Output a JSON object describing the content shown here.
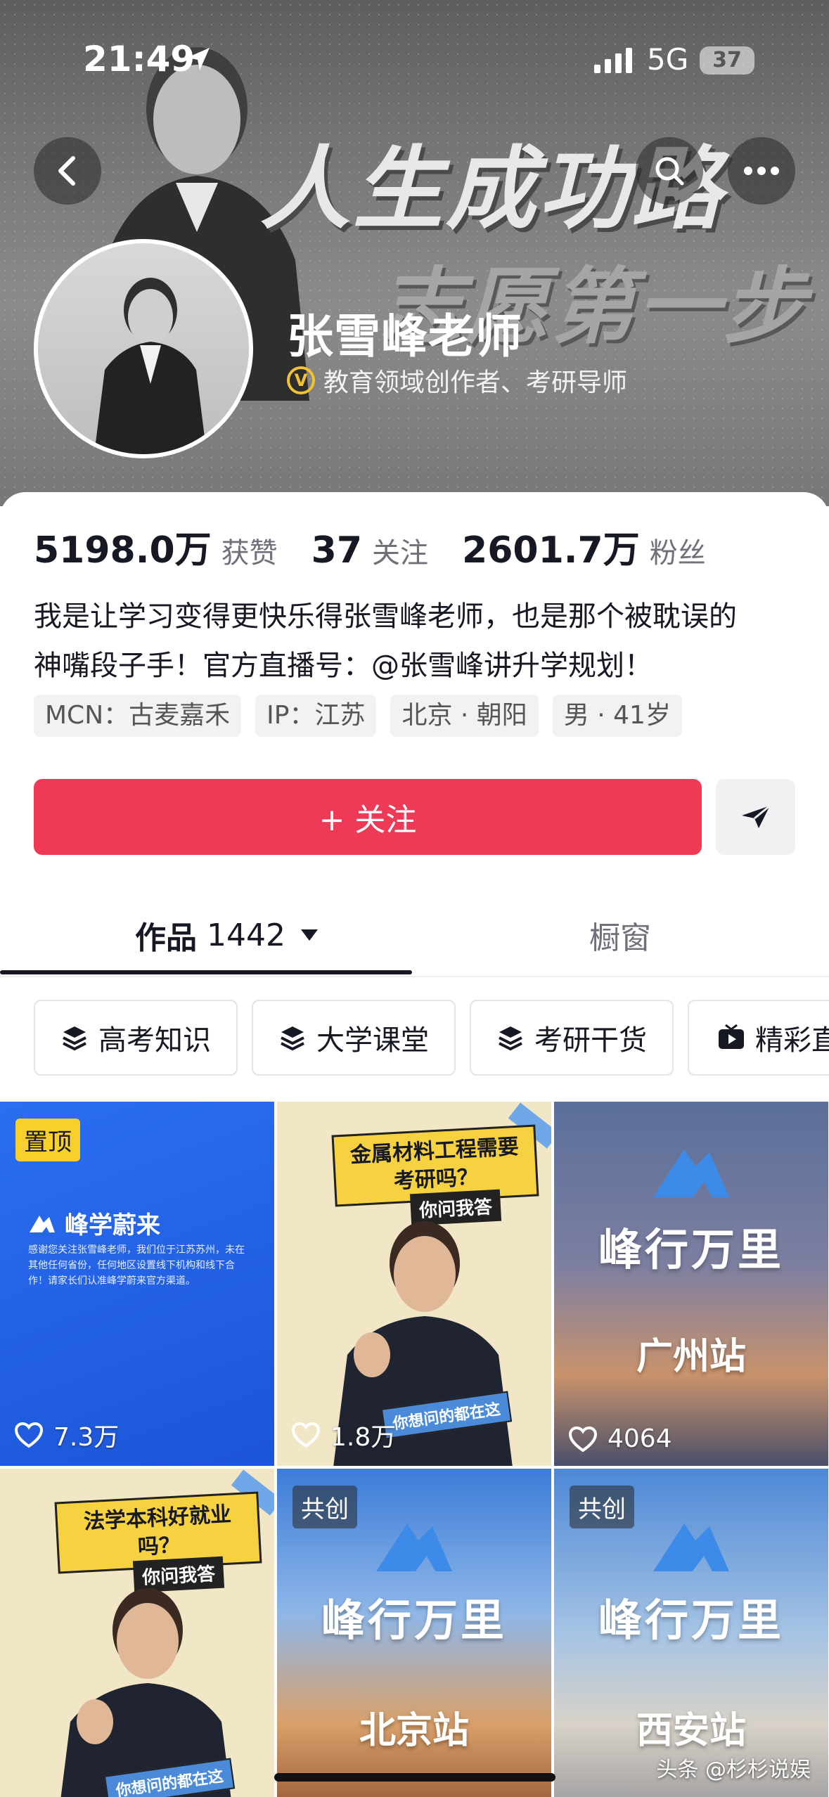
{
  "status_bar": {
    "time": "21:49",
    "network": "5G",
    "battery": "37"
  },
  "banner": {
    "headline_line1": "人生成功路",
    "headline_line2": "志愿第一步"
  },
  "profile": {
    "name": "张雪峰老师",
    "verify_badge": "V",
    "verification": "教育领域创作者、考研导师",
    "stats": [
      {
        "value": "5198.0万",
        "label": "获赞"
      },
      {
        "value": "37",
        "label": "关注"
      },
      {
        "value": "2601.7万",
        "label": "粉丝"
      }
    ],
    "bio_line1": "我是让学习变得更快乐得张雪峰老师，也是那个被耽误的",
    "bio_line2": "神嘴段子手！官方直播号：@张雪峰讲升学规划！",
    "tags": [
      "MCN：古麦嘉禾",
      "IP：江苏",
      "北京 · 朝阳",
      "男 · 41岁"
    ]
  },
  "actions": {
    "follow_label": "+ 关注"
  },
  "tabs": {
    "works_label": "作品",
    "works_count": "1442",
    "shop_label": "橱窗"
  },
  "collections": [
    "高考知识",
    "大学课堂",
    "考研干货",
    "精彩直"
  ],
  "videos": [
    {
      "badge": "置顶",
      "brand": "峰学蔚来",
      "note": "感谢您关注张雪峰老师，我们位于江苏苏州，未在其他任何省份，任何地区设置线下机构和线下合作！请家长们认准峰学蔚来官方渠道。",
      "likes": "7.3万"
    },
    {
      "title": "金属材料工程需要考研吗？",
      "subtitle": "你问我答",
      "strip": "你想问的都在这",
      "likes": "1.8万"
    },
    {
      "title": "峰行万里",
      "city": "广州站",
      "likes": "4064"
    },
    {
      "title": "法学本科好就业吗？",
      "subtitle": "你问我答",
      "strip": "你想问的都在这"
    },
    {
      "badge": "共创",
      "title": "峰行万里",
      "city": "北京站"
    },
    {
      "badge": "共创",
      "title": "峰行万里",
      "city": "西安站"
    }
  ],
  "watermark": "头条 @杉杉说娱",
  "colors": {
    "follow": "#ee3a56",
    "pin_badge": "#f7d02c",
    "verify": "#f2c230"
  }
}
